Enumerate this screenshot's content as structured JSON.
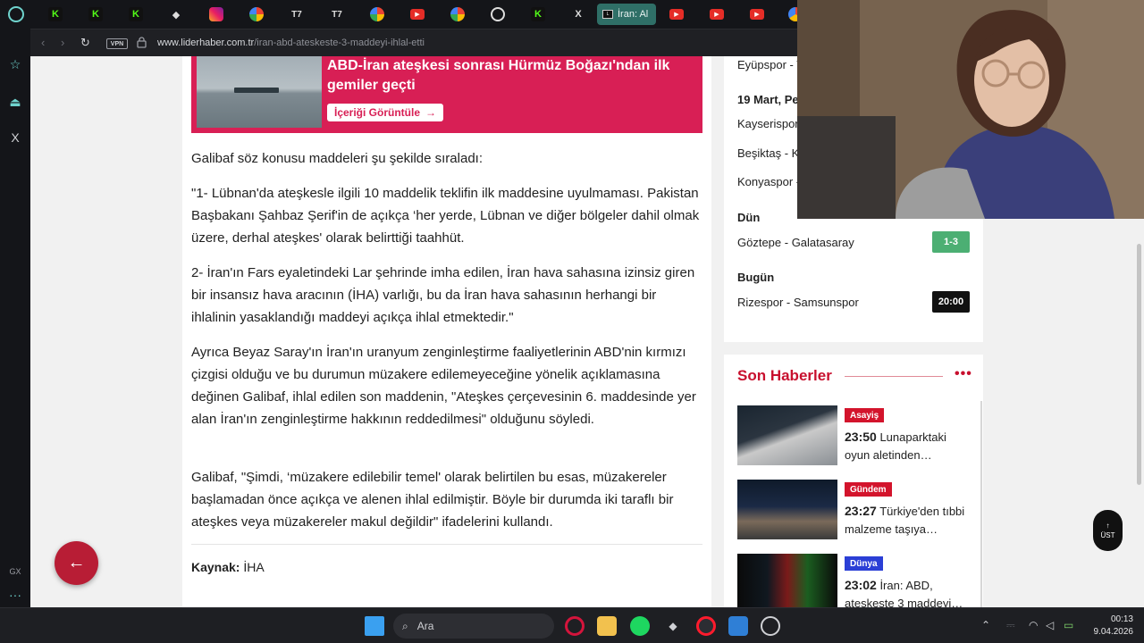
{
  "browser": {
    "active_tab_label": "İran: Al",
    "vpn_label": "VPN",
    "url_domain": "www.liderhaber.com.tr",
    "url_path": "/iran-abd-ateskeste-3-maddeyi-ihlal-etti"
  },
  "banner": {
    "title": "ABD-İran ateşkesi sonrası Hürmüz Boğazı'ndan ilk gemiler geçti",
    "button_label": "İçeriği Görüntüle",
    "button_arrow": "→"
  },
  "article": {
    "paragraphs": [
      "Galibaf söz konusu maddeleri şu şekilde sıraladı:",
      "\"1- Lübnan'da ateşkesle ilgili 10 maddelik teklifin ilk maddesine uyulmaması. Pakistan Başbakanı Şahbaz Şerif'in de açıkça ‘her yerde, Lübnan ve diğer bölgeler dahil olmak üzere, derhal ateşkes' olarak belirttiği taahhüt.",
      "2- İran'ın Fars eyaletindeki Lar şehrinde imha edilen, İran hava sahasına izinsiz giren bir insansız hava aracının (İHA) varlığı, bu da İran hava sahasının herhangi bir ihlalinin yasaklandığı maddeyi açıkça ihlal etmektedir.\"",
      "Ayrıca Beyaz Saray'ın İran'ın uranyum zenginleştirme faaliyetlerinin ABD'nin kırmızı çizgisi olduğu ve bu durumun müzakere edilemeyeceğine yönelik açıklamasına değinen Galibaf, ihlal edilen son maddenin, \"Ateşkes çerçevesinin 6. maddesinde yer alan İran'ın zenginleştirme hakkının reddedilmesi\" olduğunu söyledi.",
      "Galibaf, \"Şimdi, ‘müzakere edilebilir temel' olarak belirtilen bu esas, müzakereler başlamadan önce açıkça ve alenen ihlal edilmiştir. Böyle bir durumda iki taraflı bir ateşkes veya müzakereler makul değildir\" ifadelerini kullandı."
    ],
    "source_label": "Kaynak:",
    "source_value": "İHA",
    "back_arrow": "←"
  },
  "fixtures": {
    "rows": [
      {
        "kind": "match",
        "text": "Eyüpspor - T"
      },
      {
        "kind": "day",
        "text": "19 Mart, Pe"
      },
      {
        "kind": "match",
        "text": "Kayserispor"
      },
      {
        "kind": "match",
        "text": "Beşiktaş - Ka"
      },
      {
        "kind": "match",
        "text": "Konyaspor -"
      },
      {
        "kind": "day",
        "text": "Dün"
      },
      {
        "kind": "match",
        "text": "Göztepe - Galatasaray",
        "score": "1-3",
        "score_color": "#4caf73"
      },
      {
        "kind": "day",
        "text": "Bugün"
      },
      {
        "kind": "match",
        "text": "Rizespor - Samsunspor",
        "score": "20:00",
        "score_color": "#111111"
      }
    ]
  },
  "news": {
    "title": "Son Haberler",
    "more": "•••",
    "items": [
      {
        "category": "Asayiş",
        "category_color": "#d3142c",
        "time": "23:50",
        "headline": "Lunaparktaki oyun aletinden…"
      },
      {
        "category": "Gündem",
        "category_color": "#d3142c",
        "time": "23:27",
        "headline": "Türkiye'den tıbbi malzeme taşıya…"
      },
      {
        "category": "Dünya",
        "category_color": "#2b3fd6",
        "time": "23:02",
        "headline": "İran: ABD, ateşkeste 3 maddeyi…"
      }
    ]
  },
  "scroll_top": {
    "arrow": "↑",
    "label": "ÜST"
  },
  "sidebar_bottom": {
    "gx": "GX",
    "more": "···"
  },
  "taskbar": {
    "search_label": "Ara",
    "clock_time": "00:13",
    "clock_date": "9.04.2026"
  }
}
